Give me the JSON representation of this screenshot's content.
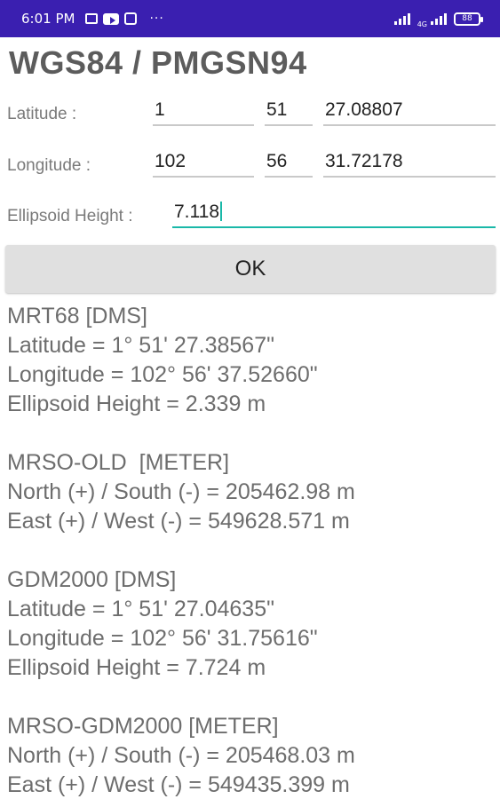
{
  "status_bar": {
    "time": "6:01 PM",
    "icons_left": [
      "message-icon",
      "youtube-icon",
      "app-icon"
    ],
    "overflow": "···",
    "network_label": "4G",
    "battery": "88",
    "colors": {
      "background": "#3a1fb0"
    }
  },
  "title": "WGS84 / PMGSN94",
  "form": {
    "latitude": {
      "label": "Latitude :",
      "deg": "1",
      "min": "51",
      "sec": "27.08807"
    },
    "longitude": {
      "label": "Longitude :",
      "deg": "102",
      "min": "56",
      "sec": "31.72178"
    },
    "height": {
      "label": "Ellipsoid Height :",
      "value": "7.118"
    },
    "accent_color": "#19b8a8"
  },
  "ok_button": {
    "label": "OK"
  },
  "results": {
    "mrt68": {
      "header": "MRT68 [DMS]",
      "latitude": "Latitude = 1° 51' 27.38567\"",
      "longitude": "Longitude = 102° 56' 37.52660\"",
      "height": "Ellipsoid Height = 2.339 m"
    },
    "mrso_old": {
      "header": "MRSO-OLD  [METER]",
      "north": "North (+) / South (-) = 205462.98 m",
      "east": "East (+) / West (-) = 549628.571 m"
    },
    "gdm2000": {
      "header": "GDM2000 [DMS]",
      "latitude": "Latitude = 1° 51' 27.04635\"",
      "longitude": "Longitude = 102° 56' 31.75616\"",
      "height": "Ellipsoid Height = 7.724 m"
    },
    "mrso_gdm2000": {
      "header": "MRSO-GDM2000 [METER]",
      "north": "North (+) / South (-) = 205468.03 m",
      "east": "East (+) / West (-) = 549435.399 m"
    }
  }
}
